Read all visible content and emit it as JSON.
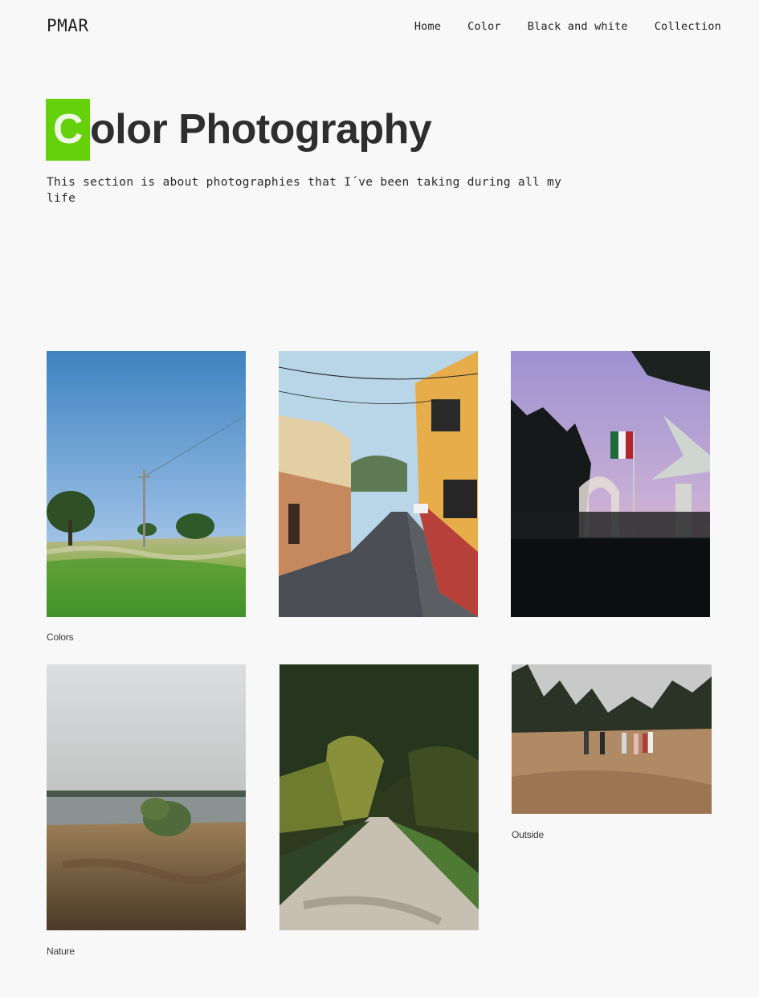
{
  "header": {
    "brand": "PMAR",
    "nav": [
      "Home",
      "Color",
      "Black and white",
      "Collection"
    ]
  },
  "hero": {
    "title_initial": "C",
    "title_rest": "olor Photography",
    "accent_color": "#64d10a",
    "intro": "This section is about photographies that I´ve been taking during all my life"
  },
  "gallery": {
    "captions": [
      "Colors",
      "Outside",
      "Nature"
    ],
    "photos": [
      {
        "subject": "meadow-with-utility-pole",
        "caption_index": 0
      },
      {
        "subject": "colonial-street-with-buildings"
      },
      {
        "subject": "flag-and-arches-at-dusk"
      },
      {
        "subject": "lake-shore-with-bush",
        "caption_index": 2
      },
      {
        "subject": "tree-lined-path"
      },
      {
        "subject": "people-walking-in-field",
        "caption_index": 1
      }
    ]
  }
}
